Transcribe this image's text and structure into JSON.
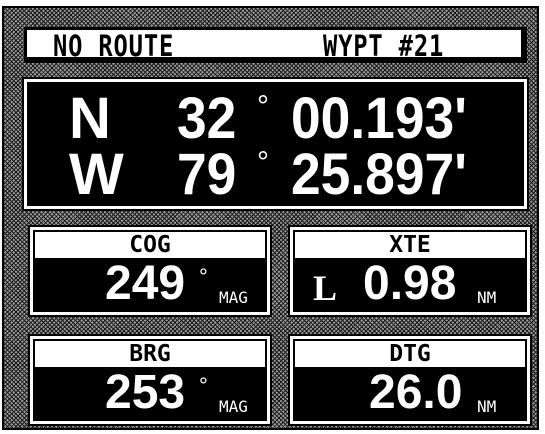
{
  "header": {
    "route_status": "NO ROUTE",
    "waypoint": "WYPT  #21"
  },
  "position": {
    "lat_hemisphere": "N",
    "lat_degrees": "32",
    "lat_minutes": "00.193'",
    "lon_hemisphere": "W",
    "lon_degrees": "79",
    "lon_minutes": "25.897'",
    "degree_symbol": "°"
  },
  "panels": {
    "cog": {
      "label": "COG",
      "value": "249",
      "degree_symbol": "°",
      "unit": "MAG"
    },
    "xte": {
      "label": "XTE",
      "direction": "L",
      "value": "0.98",
      "unit": "NM"
    },
    "brg": {
      "label": "BRG",
      "value": "253",
      "degree_symbol": "°",
      "unit": "MAG"
    },
    "dtg": {
      "label": "DTG",
      "value": "26.0",
      "unit": "NM"
    }
  },
  "colors": {
    "background_pattern": "#9a9a9a",
    "panel_fill": "#000000",
    "label_fill": "#ffffff"
  }
}
